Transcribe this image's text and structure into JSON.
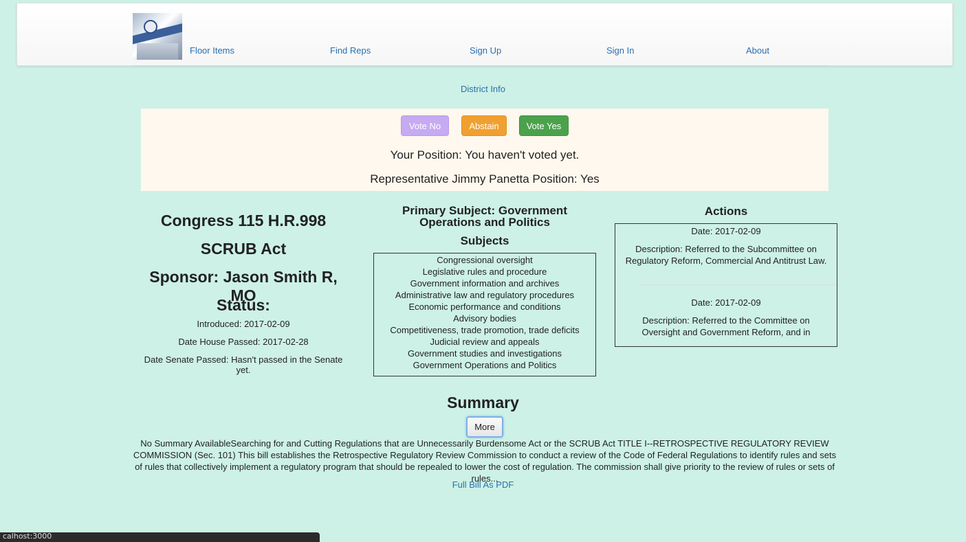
{
  "nav": {
    "items": [
      "Floor Items",
      "Find Reps",
      "Sign Up",
      "Sign In",
      "About"
    ]
  },
  "district_link": "District Info",
  "vote": {
    "no_label": "Vote No",
    "abstain_label": "Abstain",
    "yes_label": "Vote Yes",
    "your_position": "Your Position: You haven't voted yet.",
    "rep_position": "Representative Jimmy Panetta Position: Yes"
  },
  "bill": {
    "congress": "Congress 115 H.R.998",
    "title": "SCRUB Act",
    "sponsor": "Sponsor: Jason Smith R, MO",
    "status_label": "Status:",
    "introduced": "Introduced: 2017-02-09",
    "house_passed": "Date House Passed: 2017-02-28",
    "senate_passed": "Date Senate Passed: Hasn't passed in the Senate yet."
  },
  "subjects": {
    "primary": "Primary Subject: Government Operations and Politics",
    "title": "Subjects",
    "items": [
      "Congressional oversight",
      "Legislative rules and procedure",
      "Government information and archives",
      "Administrative law and regulatory procedures",
      "Economic performance and conditions",
      "Advisory bodies",
      "Competitiveness, trade promotion, trade deficits",
      "Judicial review and appeals",
      "Government studies and investigations",
      "Government Operations and Politics"
    ]
  },
  "actions": {
    "title": "Actions",
    "items": [
      {
        "date": "Date: 2017-02-09",
        "description": "Description: Referred to the Subcommittee on Regulatory Reform, Commercial And Antitrust Law."
      },
      {
        "date": "Date: 2017-02-09",
        "description": "Description: Referred to the Committee on Oversight and Government Reform, and in"
      }
    ]
  },
  "summary": {
    "title": "Summary",
    "more_label": "More",
    "text": "No Summary AvailableSearching for and Cutting Regulations that are Unnecessarily Burdensome Act or the SCRUB Act TITLE I--RETROSPECTIVE REGULATORY REVIEW COMMISSION (Sec. 101) This bill establishes the Retrospective Regulatory Review Commission to conduct a review of the Code of Federal Regulations to identify rules and sets of rules that collectively implement a regulatory program that should be repealed to lower the cost of regulation. The commission shall give priority to the review of rules or sets of rules...",
    "pdf_link": "Full Bill As PDF"
  },
  "status_bar": "calhost:3000"
}
